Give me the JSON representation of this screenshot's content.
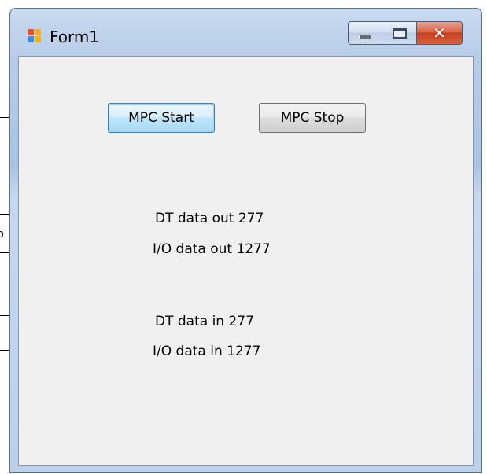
{
  "window": {
    "title": "Form1",
    "app_icon": "winforms-app-icon",
    "controls": {
      "minimize": "minimize-icon",
      "maximize": "maximize-icon",
      "close_glyph": "✕"
    }
  },
  "buttons": {
    "start_label": "MPC Start",
    "stop_label": "MPC Stop"
  },
  "labels": {
    "dt_out": "DT data out 277",
    "io_out": "I/O data out 1277",
    "dt_in": "DT data in 277",
    "io_in": "I/O data in 1277"
  },
  "annotations": {
    "stray_mark": "b"
  },
  "colors": {
    "title_bar": "#b9cde9",
    "client_bg": "#f0f0f0",
    "close_button": "#c8401e",
    "focus_border": "#3c7fb1"
  }
}
